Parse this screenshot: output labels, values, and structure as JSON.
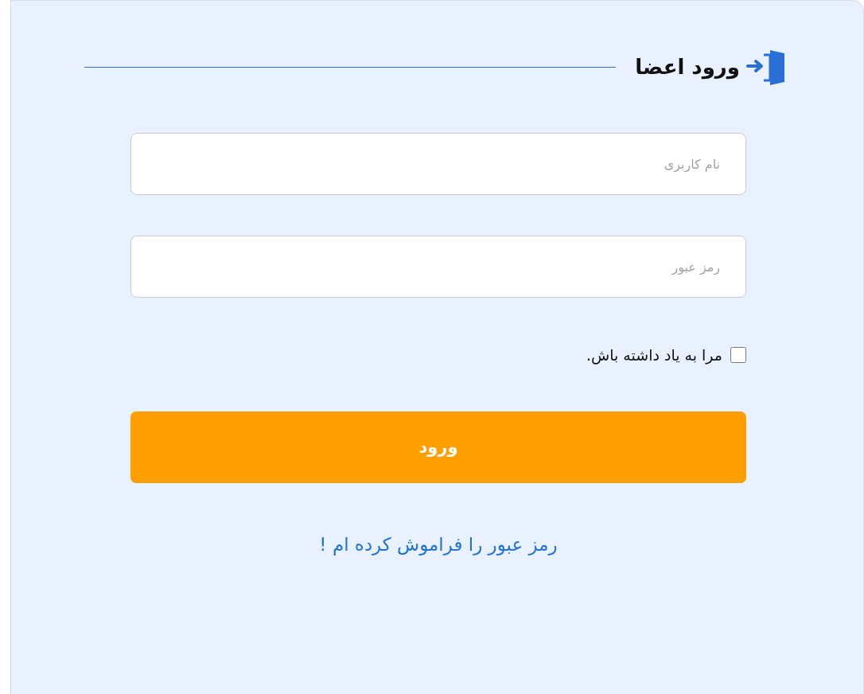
{
  "title": "ورود اعضا",
  "fields": [
    {
      "placeholder": "نام کاربری"
    },
    {
      "placeholder": "رمز عبور"
    }
  ],
  "remember": {
    "label": "مرا به یاد داشته باش.",
    "checked": false
  },
  "submit": "ورود",
  "forgot_link": "رمز عبور را فراموش کرده ام !"
}
